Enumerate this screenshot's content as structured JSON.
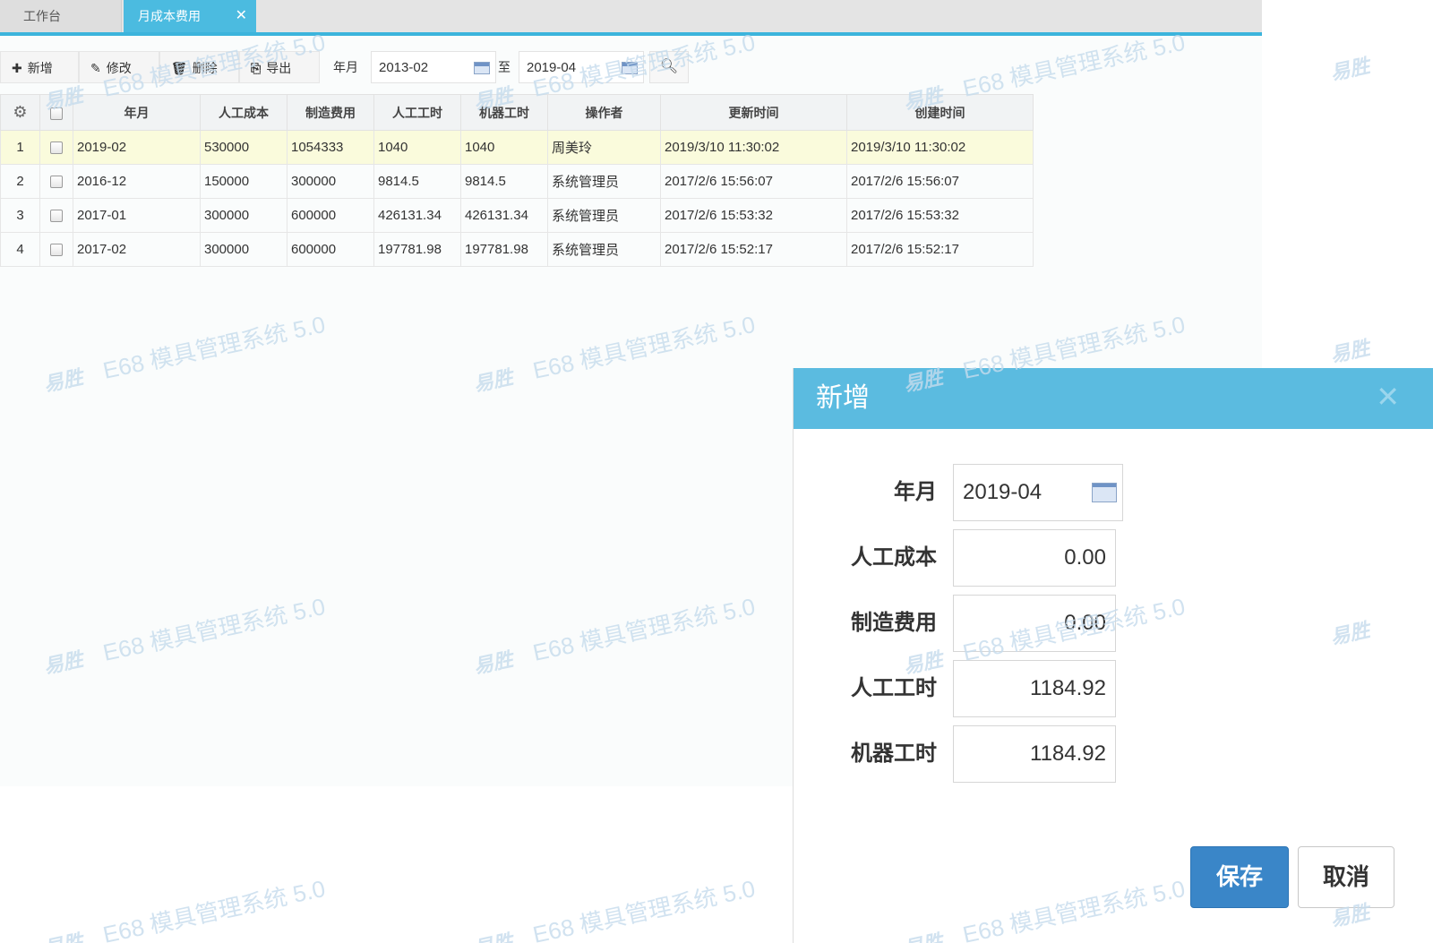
{
  "tabs": [
    {
      "label": "工作台"
    },
    {
      "label": "月成本费用",
      "close": "✕"
    }
  ],
  "toolbar": {
    "add_label": "新增",
    "edit_label": "修改",
    "delete_label": "删除",
    "export_label": "导出",
    "month_label": "年月",
    "from_value": "2013-02",
    "to_label": "至",
    "to_value": "2019-04"
  },
  "table": {
    "headers": [
      "年月",
      "人工成本",
      "制造费用",
      "人工工时",
      "机器工时",
      "操作者",
      "更新时间",
      "创建时间"
    ],
    "rows": [
      {
        "no": "1",
        "month": "2019-02",
        "labor": "530000",
        "mfg": "1054333",
        "labor_hours": "1040",
        "machine_hours": "1040",
        "operator": "周美玲",
        "updated": "2019/3/10 11:30:02",
        "created": "2019/3/10 11:30:02"
      },
      {
        "no": "2",
        "month": "2016-12",
        "labor": "150000",
        "mfg": "300000",
        "labor_hours": "9814.5",
        "machine_hours": "9814.5",
        "operator": "系统管理员",
        "updated": "2017/2/6 15:56:07",
        "created": "2017/2/6 15:56:07"
      },
      {
        "no": "3",
        "month": "2017-01",
        "labor": "300000",
        "mfg": "600000",
        "labor_hours": "426131.34",
        "machine_hours": "426131.34",
        "operator": "系统管理员",
        "updated": "2017/2/6 15:53:32",
        "created": "2017/2/6 15:53:32"
      },
      {
        "no": "4",
        "month": "2017-02",
        "labor": "300000",
        "mfg": "600000",
        "labor_hours": "197781.98",
        "machine_hours": "197781.98",
        "operator": "系统管理员",
        "updated": "2017/2/6 15:52:17",
        "created": "2017/2/6 15:52:17"
      }
    ]
  },
  "dialog": {
    "title": "新增",
    "close": "✕",
    "fields": {
      "month_label": "年月",
      "month_value": "2019-04",
      "labor_label": "人工成本",
      "labor_value": "0.00",
      "mfg_label": "制造费用",
      "mfg_value": "0.00",
      "labor_hours_label": "人工工时",
      "labor_hours_value": "1184.92",
      "machine_hours_label": "机器工时",
      "machine_hours_value": "1184.92"
    },
    "save_label": "保存",
    "cancel_label": "取消"
  },
  "watermark": {
    "logo": "易胜",
    "brand": "E68 模具管理系统 5.0"
  },
  "colors": {
    "accent": "#3cb4dc",
    "dialog_header": "#5bbbe0",
    "save_button": "#3a86c8",
    "selected_row": "#fafbdc"
  }
}
